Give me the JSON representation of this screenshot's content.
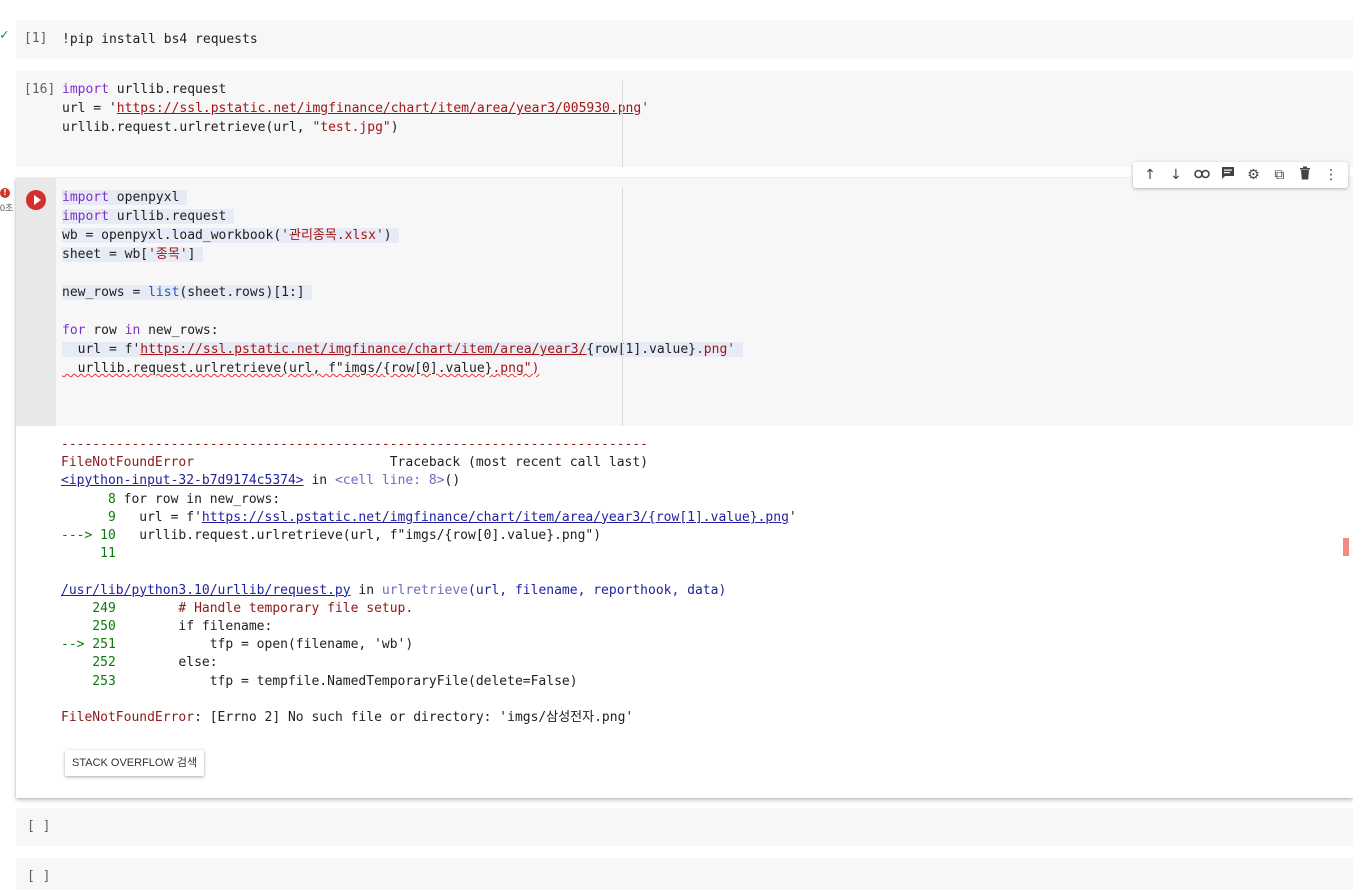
{
  "cells": [
    {
      "exec_count": "[1]",
      "lines": [
        "!pip install bs4 requests"
      ]
    },
    {
      "exec_count": "[16]",
      "lines": [
        [
          "import",
          " urllib.request"
        ],
        [
          "url = '",
          "https://ssl.pstatic.net/imgfinance/chart/item/area/year3/005930.png",
          "'"
        ],
        [
          "urllib.request.urlretrieve(url, ",
          "\"test.jpg\"",
          ")"
        ]
      ]
    },
    {
      "exec_count": "",
      "error_badge": "!",
      "elapsed": "0초",
      "lines": [
        [
          "import",
          " openpyxl"
        ],
        [
          "import",
          " urllib.request"
        ],
        [
          "wb = openpyxl.load_workbook(",
          "'관리종목.xlsx'",
          ")"
        ],
        [
          "sheet = wb[",
          "'종목'",
          "]"
        ],
        [
          ""
        ],
        [
          "new_rows = ",
          "list",
          "(sheet.rows)[1:]"
        ],
        [
          ""
        ],
        [
          "for",
          " row ",
          "in",
          " new_rows:"
        ],
        [
          "  url = f'",
          "https://ssl.pstatic.net/imgfinance/chart/item/area/year3/",
          "{row[1].value}",
          ".png'"
        ],
        [
          "  urllib.request.urlretrieve(url, f\"imgs/",
          "{row[0].value}",
          ".png\")"
        ]
      ]
    },
    {
      "exec_count": "[ ]"
    },
    {
      "exec_count": "[ ]"
    }
  ],
  "toolbar": {
    "up": "↑",
    "down": "↓",
    "link": "⊘",
    "comment": "▤",
    "settings": "⚙",
    "mirror": "⧉",
    "delete": "🗑",
    "more": "⋮"
  },
  "traceback": {
    "rule": "---------------------------------------------------------------------------",
    "error_name": "FileNotFoundError",
    "header_right": "Traceback (most recent call last)",
    "frame1_link": "<ipython-input-32-b7d9174c5374>",
    "frame1_in": " in ",
    "frame1_fn": "<cell line: 8>",
    "frame1_paren": "()",
    "frame1_lines": [
      {
        "num": "      8",
        "code": " for row in new_rows:"
      },
      {
        "num": "      9",
        "code": "   url = f'",
        "url": "https://ssl.pstatic.net/imgfinance/chart/item/area/year3/{row[1].value}.png",
        "tail": "'"
      },
      {
        "num": "---> 10",
        "code": "   urllib.request.urlretrieve(url, f\"imgs/{row[0].value}.png\")"
      },
      {
        "num": "     11",
        "code": ""
      }
    ],
    "frame2_link": "/usr/lib/python3.10/urllib/request.py",
    "frame2_in": " in ",
    "frame2_fn": "urlretrieve",
    "frame2_args": "(url, filename, reporthook, data)",
    "frame2_lines": [
      {
        "num": "    249",
        "code": "        # Handle temporary file setup."
      },
      {
        "num": "    250",
        "code": "        if filename:"
      },
      {
        "num": "--> 251",
        "code": "            tfp = open(filename, 'wb')"
      },
      {
        "num": "    252",
        "code": "        else:"
      },
      {
        "num": "    253",
        "code": "            tfp = tempfile.NamedTemporaryFile(delete=False)"
      }
    ],
    "final_name": "FileNotFoundError",
    "final_msg": ": [Errno 2] No such file or directory: 'imgs/삼성전자.png'"
  },
  "so_button": "STACK OVERFLOW 검색"
}
